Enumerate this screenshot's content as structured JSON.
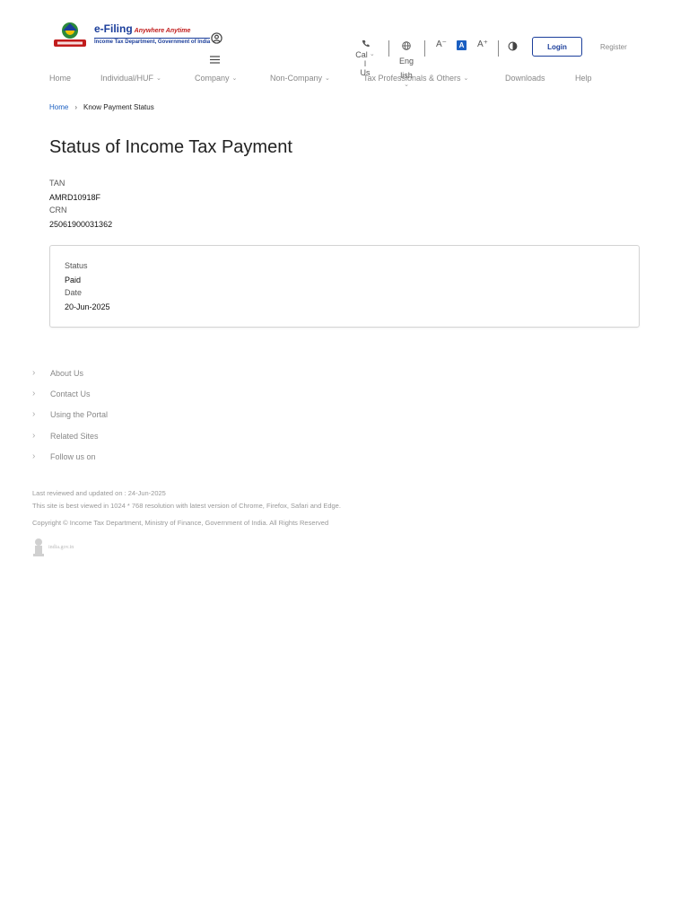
{
  "header": {
    "logo": {
      "title": "e-Filing",
      "tagline": "Anywhere Anytime",
      "subtitle": "Income Tax Department, Government of India"
    },
    "call_us": {
      "line1": "Cal",
      "line2": "l",
      "line3": "Us"
    },
    "language": {
      "line1": "Eng",
      "line2": "lish"
    },
    "font_controls": {
      "decrease": "A⁻",
      "normal": "A",
      "increase": "A⁺"
    },
    "login_label": "Login",
    "register_label": "Register"
  },
  "nav": {
    "items": [
      {
        "label": "Home"
      },
      {
        "label": "Individual/HUF"
      },
      {
        "label": "Company"
      },
      {
        "label": "Non-Company"
      },
      {
        "label": "Tax Professionals & Others"
      },
      {
        "label": "Downloads"
      },
      {
        "label": "Help"
      }
    ]
  },
  "breadcrumb": {
    "home": "Home",
    "current": "Know Payment Status"
  },
  "page": {
    "title": "Status of Income Tax Payment",
    "tan_label": "TAN",
    "tan_value": "AMRD10918F",
    "crn_label": "CRN",
    "crn_value": "25061900031362"
  },
  "status_card": {
    "status_label": "Status",
    "status_value": "Paid",
    "date_label": "Date",
    "date_value": "20-Jun-2025"
  },
  "footer": {
    "links": [
      "About Us",
      "Contact Us",
      "Using the Portal",
      "Related Sites",
      "Follow us on"
    ],
    "last_reviewed": "Last reviewed and updated on : 24-Jun-2025",
    "best_viewed": "This site is best viewed in 1024 * 768 resolution with latest version of Chrome, Firefox, Safari and Edge.",
    "copyright": "Copyright © Income Tax Department, Ministry of Finance, Government of India. All Rights Reserved",
    "india_gov": "india.gov.in"
  },
  "colors": {
    "brand_blue": "#1b3e9b",
    "link_blue": "#1b5fc1",
    "logo_red": "#c11c1c"
  },
  "icons": [
    "emblem-icon",
    "profile-icon",
    "hamburger-icon",
    "phone-icon",
    "globe-icon",
    "contrast-icon",
    "chevron-down-icon",
    "chevron-right-icon"
  ]
}
